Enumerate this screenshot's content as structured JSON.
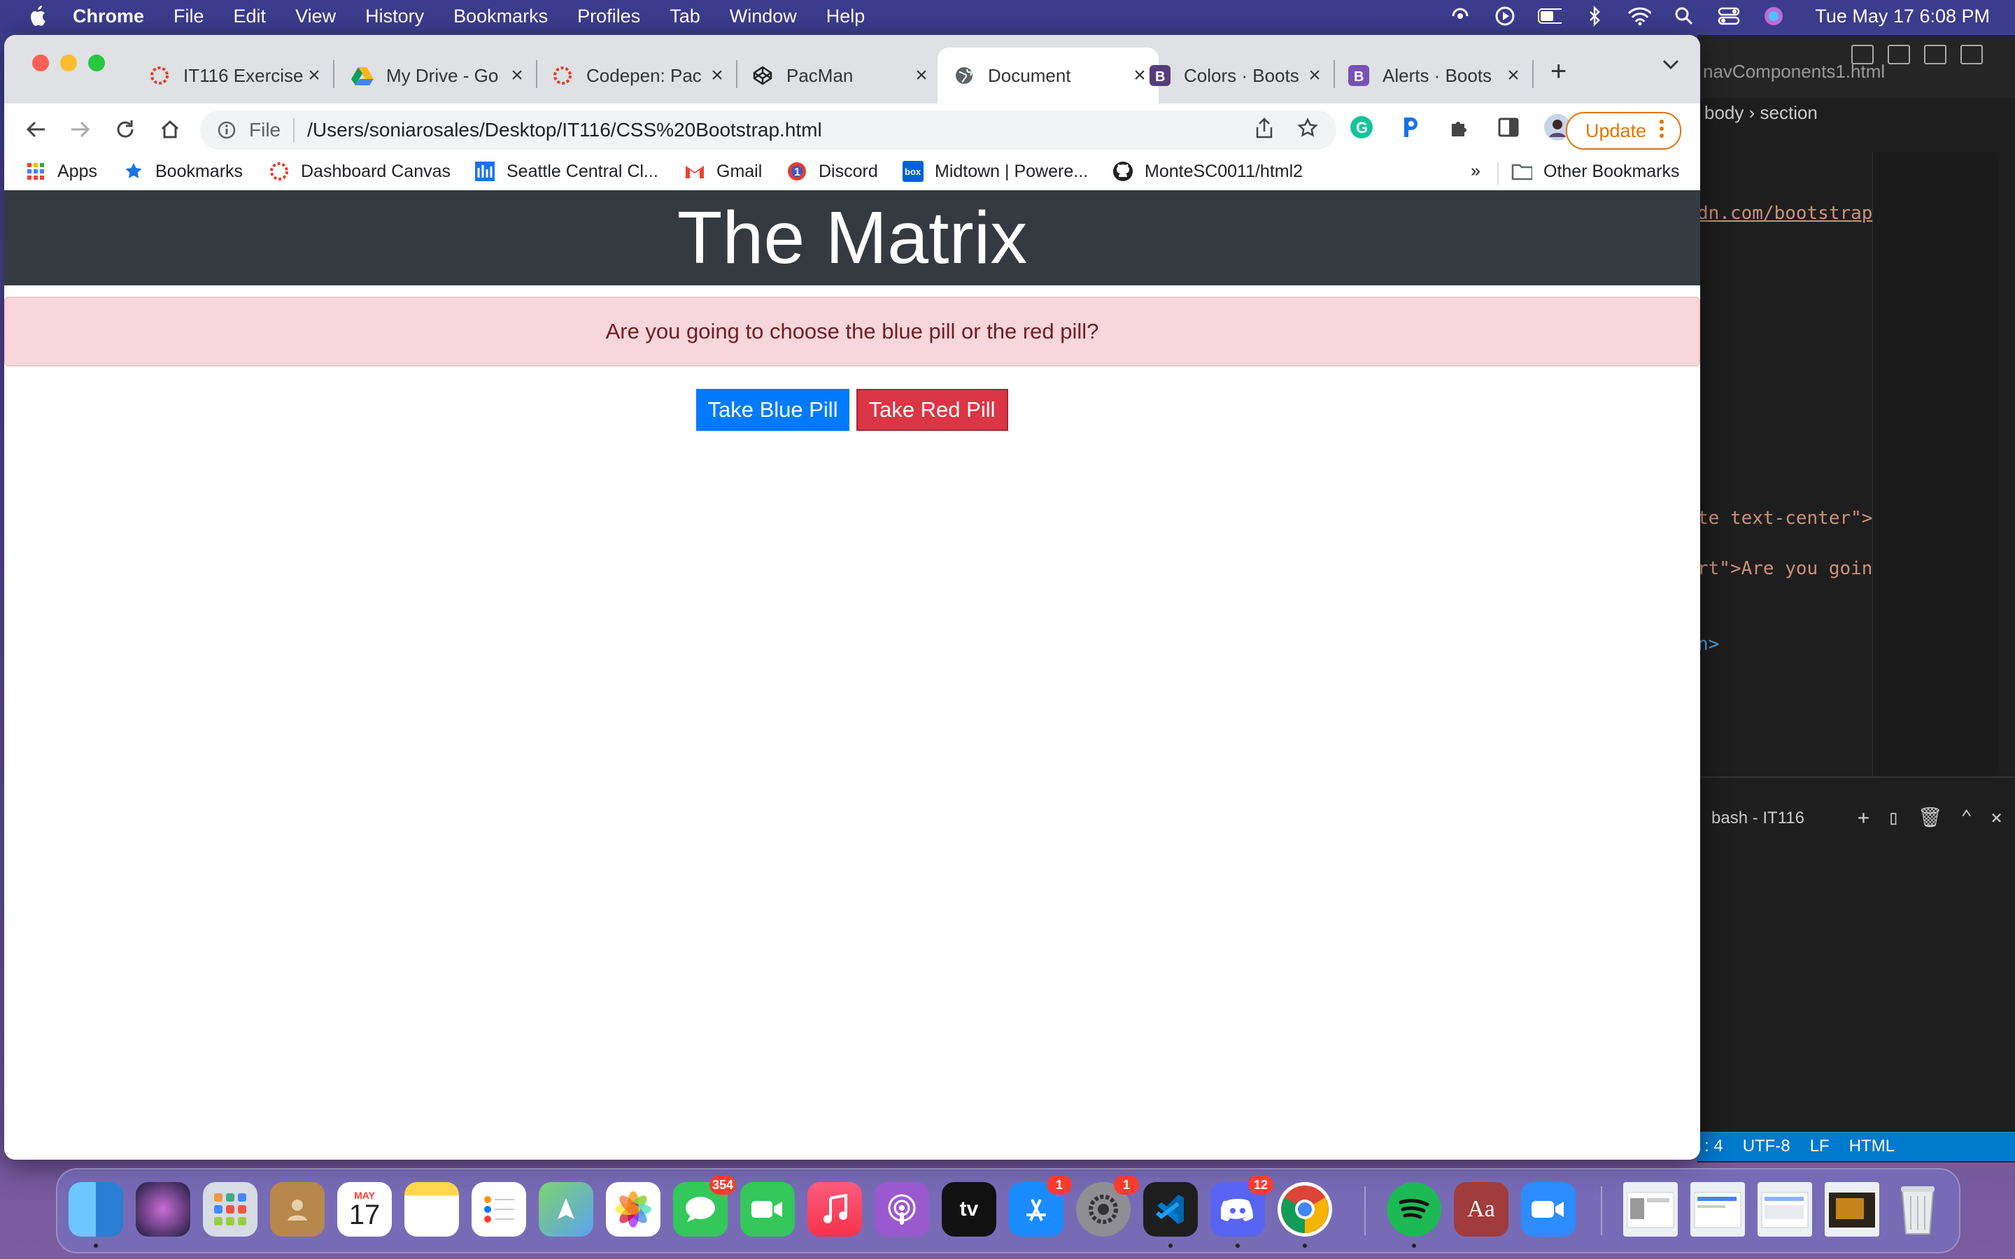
{
  "menubar": {
    "app": "Chrome",
    "items": [
      "File",
      "Edit",
      "View",
      "History",
      "Bookmarks",
      "Profiles",
      "Tab",
      "Window",
      "Help"
    ],
    "clock": "Tue May 17  6:08 PM"
  },
  "tabs": [
    {
      "title": "IT116 Exercise",
      "icon": "canvas-icon"
    },
    {
      "title": "My Drive - Go",
      "icon": "google-drive-icon"
    },
    {
      "title": "Codepen: Pac",
      "icon": "canvas-icon"
    },
    {
      "title": "PacMan",
      "icon": "codepen-icon"
    },
    {
      "title": "Document",
      "icon": "globe-icon",
      "active": true
    },
    {
      "title": "Colors · Boots",
      "icon": "bootstrap-icon"
    },
    {
      "title": "Alerts · Boots",
      "icon": "bootstrap-icon"
    }
  ],
  "omnibox": {
    "scheme": "File",
    "url": "/Users/soniarosales/Desktop/IT116/CSS%20Bootstrap.html"
  },
  "update_label": "Update",
  "bookmarks": [
    {
      "label": "Apps",
      "icon": "apps-grid-icon"
    },
    {
      "label": "Bookmarks",
      "icon": "star-icon"
    },
    {
      "label": "Dashboard Canvas",
      "icon": "canvas-icon"
    },
    {
      "label": "Seattle Central Cl...",
      "icon": "seattle-central-icon"
    },
    {
      "label": "Gmail",
      "icon": "gmail-icon"
    },
    {
      "label": "Discord",
      "icon": "discord-icon"
    },
    {
      "label": "Midtown | Powere...",
      "icon": "box-icon"
    },
    {
      "label": "MonteSC0011/html2",
      "icon": "github-icon"
    }
  ],
  "bookmarks_overflow": "»",
  "other_bookmarks": "Other Bookmarks",
  "page": {
    "heading": "The Matrix",
    "alert": "Are you going to choose the blue pill or the red pill?",
    "blue_button": "Take Blue Pill",
    "red_button": "Take Red Pill"
  },
  "vscode": {
    "tab_title": "navComponents1.html",
    "breadcrumb_body": "body",
    "breadcrumb_section": "section",
    "code_line1": "dn.com/bootstrap/",
    "code_line2": "te text-center\">T",
    "code_line3": "rt\">Are you going",
    "code_line4": "n>",
    "terminal_title": "bash - IT116",
    "status": [
      ": 4",
      "UTF-8",
      "LF",
      "HTML"
    ]
  },
  "dock": {
    "messages_badge": "354",
    "appstore_badge": "1",
    "settings_badge": "1",
    "discord_badge": "12",
    "calendar_month": "MAY",
    "calendar_day": "17",
    "dictionary_label": "Aa",
    "tv_label": "tv"
  },
  "colors": {
    "primary": "#007bff",
    "danger": "#dc3545",
    "dark": "#343a40",
    "alert_bg": "#f8d7da",
    "alert_text": "#721c24"
  }
}
